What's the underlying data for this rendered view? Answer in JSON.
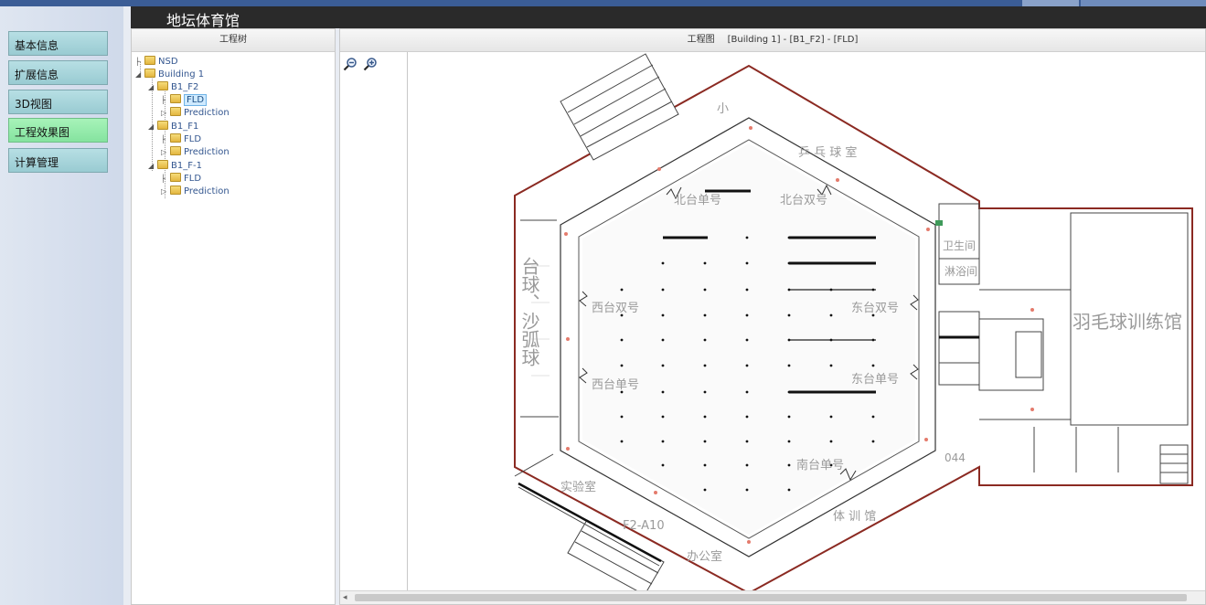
{
  "app": {
    "title": "地坛体育馆"
  },
  "nav": {
    "items": [
      {
        "label": "基本信息"
      },
      {
        "label": "扩展信息"
      },
      {
        "label": "3D视图"
      },
      {
        "label": "工程效果图"
      },
      {
        "label": "计算管理"
      }
    ],
    "active_index": 3
  },
  "tree": {
    "header": "工程树",
    "nodes": [
      {
        "label": "NSD"
      },
      {
        "label": "Building 1"
      },
      {
        "label": "B1_F2"
      },
      {
        "label": "FLD",
        "selected": true
      },
      {
        "label": "Prediction"
      },
      {
        "label": "B1_F1"
      },
      {
        "label": "FLD"
      },
      {
        "label": "Prediction"
      },
      {
        "label": "B1_F-1"
      },
      {
        "label": "FLD"
      },
      {
        "label": "Prediction"
      }
    ]
  },
  "drawing": {
    "header_title": "工程图",
    "header_path": "[Building 1] - [B1_F2] - [FLD]",
    "zoom_out_icon": "zoom-out-icon",
    "zoom_in_icon": "zoom-in-icon",
    "labels": {
      "north_single": "北台单号",
      "north_double": "北台双号",
      "west_double": "西台双号",
      "west_single": "西台单号",
      "east_double": "东台双号",
      "east_single": "东台单号",
      "south_single": "南台单号",
      "pingpong": "乒 乓 球 室",
      "billiards": "台球、沙弧球",
      "badminton": "羽毛球训练馆",
      "lab": "实验室",
      "office": "办公室",
      "f2_a10": "F2-A10",
      "room_044": "044",
      "tiaojian": "体 训 馆",
      "xiaoyi": "小",
      "wc": "卫生间",
      "bath": "淋浴间"
    }
  },
  "colors": {
    "topbar": "#3b5d96",
    "titlebar": "#2a2a2a",
    "nav_button": "#a9d6dc",
    "nav_active": "#96eaad",
    "outline_red": "#8b2a22"
  }
}
